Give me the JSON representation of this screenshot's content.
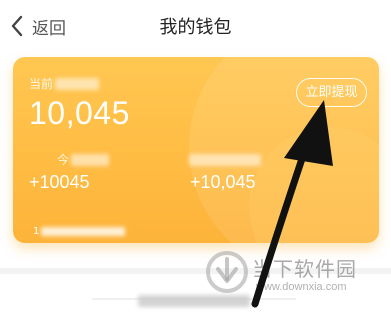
{
  "header": {
    "back_label": "返回",
    "title": "我的钱包"
  },
  "card": {
    "balance_label": "当前",
    "balance_value": "10,045",
    "withdraw_label": "立即提现",
    "stat1_label": "今",
    "stat1_value": "+10045",
    "stat2_value": "+10,045",
    "footer_label": "1"
  },
  "watermark": {
    "name": "当下软件园",
    "url": "www.downxia.com"
  },
  "colors": {
    "card_gradient_top": "#ffc752",
    "card_gradient_bottom": "#fdb33a",
    "annotation_arrow": "#111111"
  },
  "icons": {
    "back": "chevron-left-icon",
    "watermark_logo": "downxia-logo-icon",
    "annotation": "pointer-arrow-icon"
  }
}
